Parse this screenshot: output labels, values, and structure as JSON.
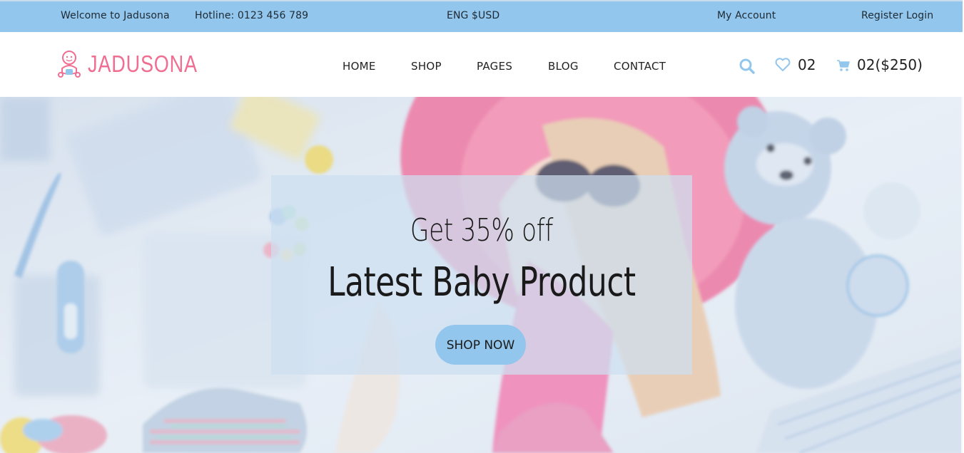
{
  "topbar": {
    "welcome": "Welcome to Jadusona",
    "hotline": "Hotline: 0123 456 789",
    "currency": "ENG $USD",
    "account": "My Account",
    "auth": "Register Login"
  },
  "brand": {
    "name": "JADUSONA",
    "color": "#ef6f92"
  },
  "nav": {
    "items": [
      "HOME",
      "SHOP",
      "PAGES",
      "BLOG",
      "CONTACT"
    ]
  },
  "header_icons": {
    "search": "search-icon",
    "wishlist": "heart-icon",
    "wishlist_count": "02",
    "cart": "cart-icon",
    "cart_summary": "02($250)"
  },
  "hero": {
    "subtitle": "Get 35% off",
    "title": "Latest Baby Product",
    "cta": "SHOP NOW"
  },
  "colors": {
    "accent": "#93c6ed",
    "brand": "#ef6f92",
    "icon": "#93c6ed"
  }
}
